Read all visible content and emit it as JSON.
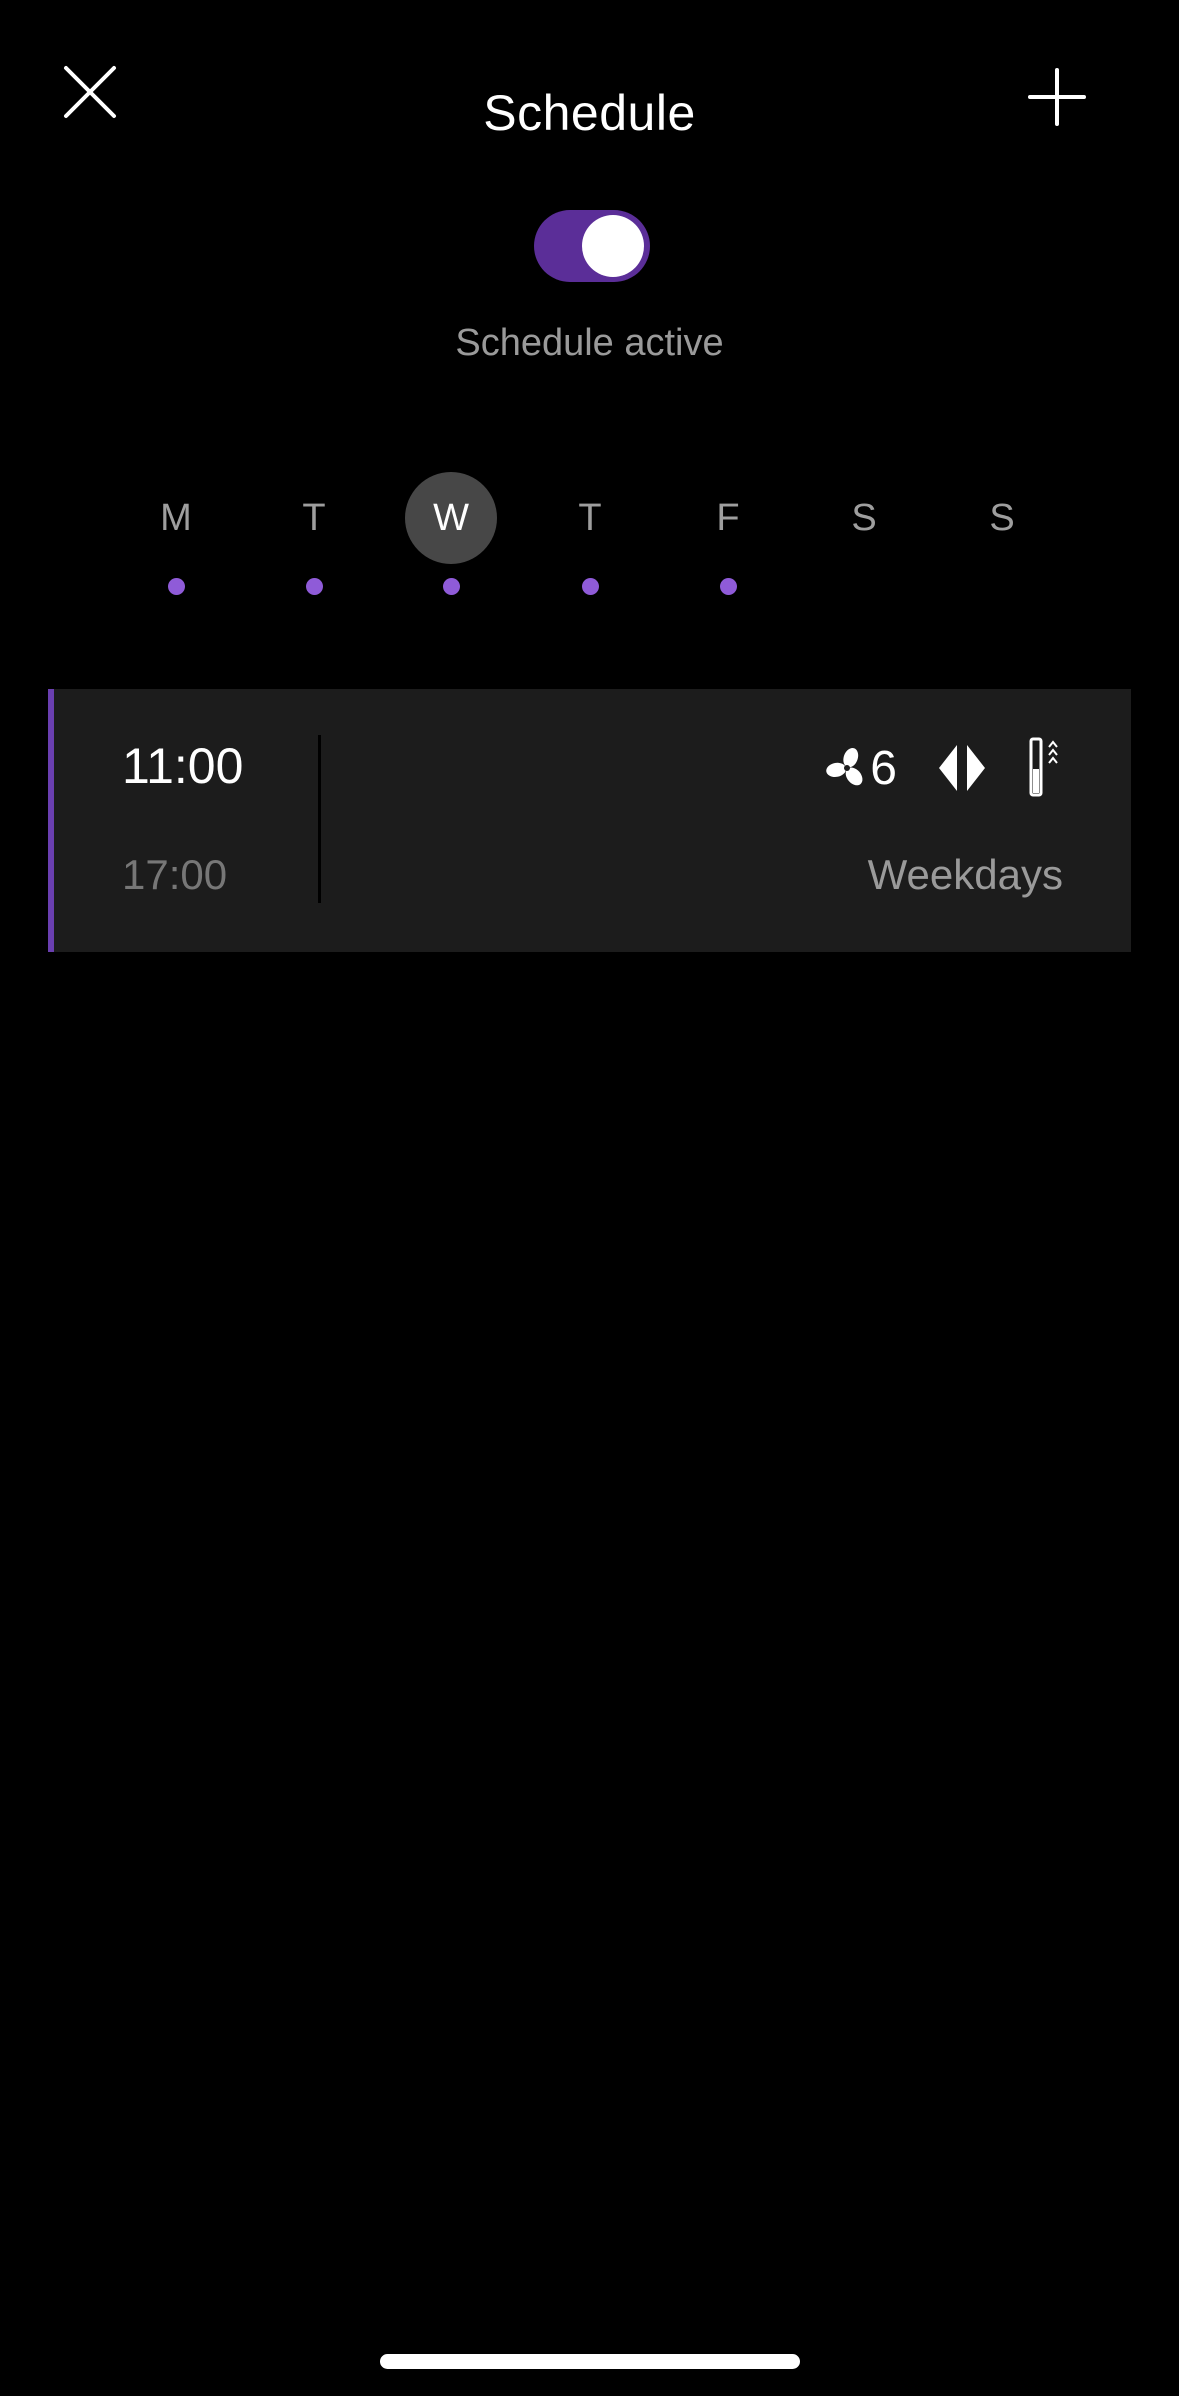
{
  "header": {
    "title": "Schedule",
    "close_icon": "close-icon",
    "add_icon": "plus-icon"
  },
  "schedule_toggle": {
    "on": true,
    "label": "Schedule active",
    "accent_color": "#5b2e98"
  },
  "days": [
    {
      "label": "M",
      "has_event": true,
      "selected": false
    },
    {
      "label": "T",
      "has_event": true,
      "selected": false
    },
    {
      "label": "W",
      "has_event": true,
      "selected": true
    },
    {
      "label": "T",
      "has_event": true,
      "selected": false
    },
    {
      "label": "F",
      "has_event": true,
      "selected": false
    },
    {
      "label": "S",
      "has_event": false,
      "selected": false
    },
    {
      "label": "S",
      "has_event": false,
      "selected": false
    }
  ],
  "schedule_entry": {
    "start": "11:00",
    "end": "17:00",
    "fan_speed": "6",
    "repeat": "Weekdays",
    "icons": [
      "fan-icon",
      "oscillation-icon",
      "heat-icon"
    ]
  },
  "colors": {
    "background": "#000000",
    "dot": "#8f5bd8",
    "card": "#1c1c1c"
  }
}
